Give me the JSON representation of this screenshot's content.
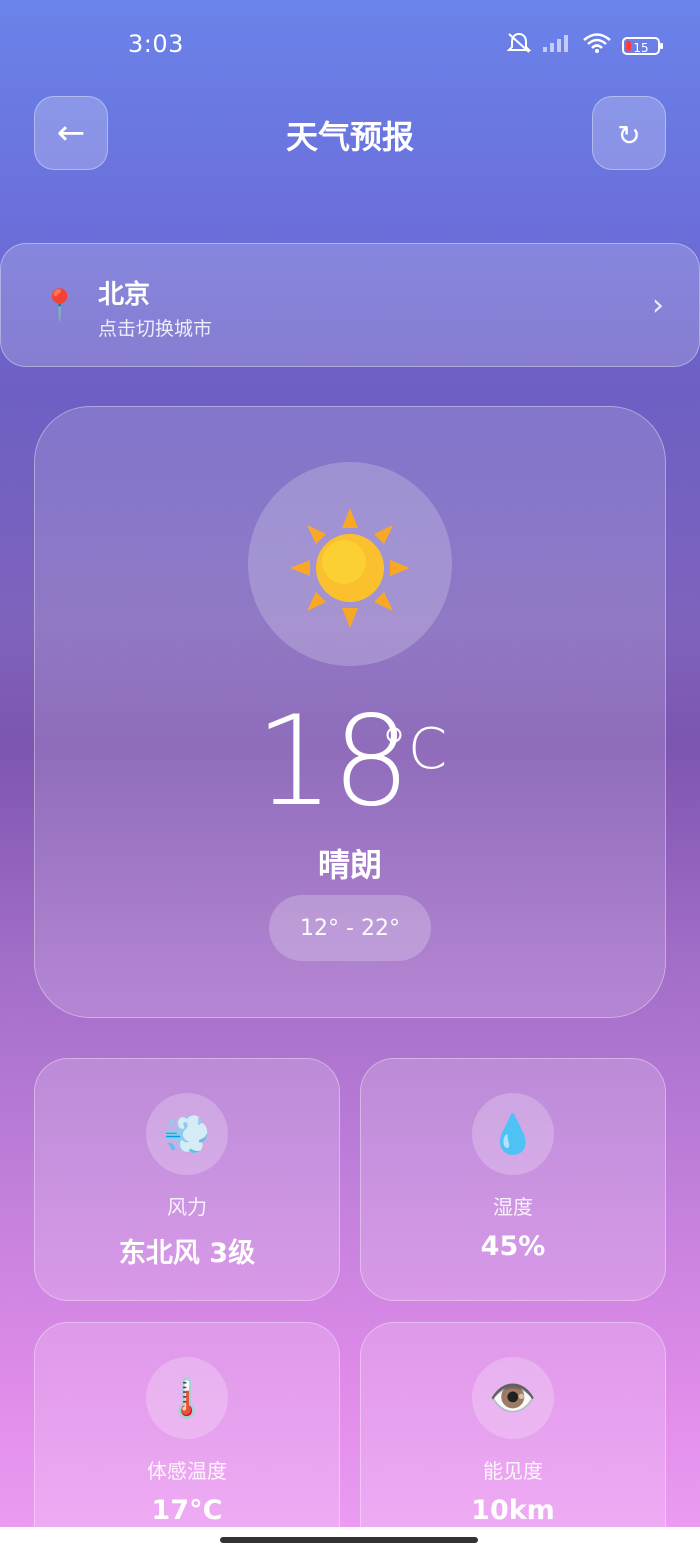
{
  "status_bar": {
    "time": "3:03",
    "battery": "15",
    "icons": [
      "mute-icon",
      "signal-icon",
      "wifi-icon",
      "battery-icon"
    ]
  },
  "header": {
    "title": "天气预报",
    "back_icon": "←",
    "refresh_icon": "↻"
  },
  "location": {
    "city": "北京",
    "hint": "点击切换城市",
    "pin_icon": "📍",
    "chevron": "›"
  },
  "current": {
    "weather_icon": "sun-icon",
    "temperature": "18",
    "unit": "°C",
    "description": "晴朗",
    "range": "12° - 22°"
  },
  "details": [
    {
      "icon": "💨",
      "label": "风力",
      "value": "东北风 3级"
    },
    {
      "icon": "💧",
      "label": "湿度",
      "value": "45%"
    },
    {
      "icon": "🌡️",
      "label": "体感温度",
      "value": "17°C"
    },
    {
      "icon": "👁️",
      "label": "能见度",
      "value": "10km"
    }
  ],
  "colors": {
    "gradient_top": "#6a83ea",
    "gradient_mid": "#7d55b0",
    "gradient_bottom": "#ee9ef3",
    "sun": "#fbc02d",
    "sun_rays": "#f9a825"
  }
}
